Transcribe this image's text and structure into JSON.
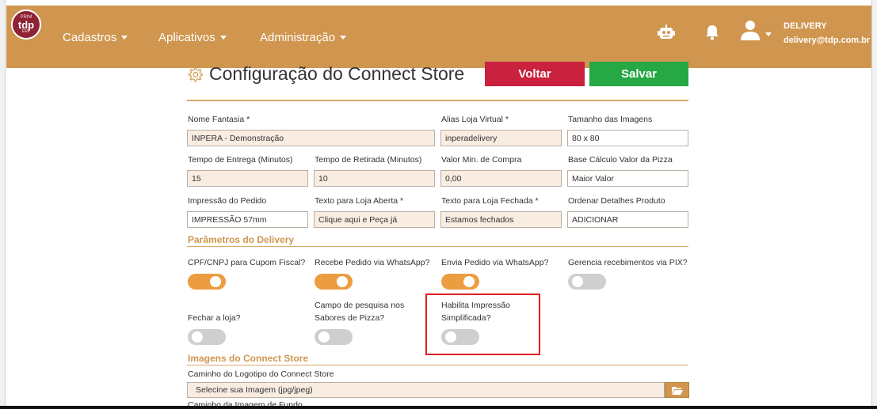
{
  "navbar": {
    "logo": {
      "top": "PRIM",
      "text": "tdp",
      "bottom": "ERP"
    },
    "menus": [
      {
        "label": "Cadastros"
      },
      {
        "label": "Aplicativos"
      },
      {
        "label": "Administração"
      }
    ],
    "user": {
      "name": "DELIVERY",
      "email": "delivery@tdp.com.br"
    },
    "colors": {
      "brand": "#d0964f"
    }
  },
  "page": {
    "title": "Configuração do Connect Store",
    "back_label": "Voltar",
    "save_label": "Salvar"
  },
  "form": {
    "nome_fantasia": {
      "label": "Nome Fantasia *",
      "value": "INPERA - Demonstração"
    },
    "alias": {
      "label": "Alias Loja Virtual *",
      "value": "inperadelivery"
    },
    "tamanho_imagens": {
      "label": "Tamanho das Imagens",
      "value": "80 x 80"
    },
    "tempo_entrega": {
      "label": "Tempo de Entrega (Minutos)",
      "value": "15"
    },
    "tempo_retirada": {
      "label": "Tempo de Retirada (Minutos)",
      "value": "10"
    },
    "valor_min": {
      "label": "Valor Min. de Compra",
      "value": "0,00"
    },
    "base_calculo": {
      "label": "Base Cálculo Valor da Pizza",
      "value": "Maior Valor"
    },
    "impressao": {
      "label": "Impressão do Pedido",
      "value": "IMPRESSÃO 57mm"
    },
    "texto_aberta": {
      "label": "Texto para Loja Aberta *",
      "value": "Clique aqui e Peça já"
    },
    "texto_fechada": {
      "label": "Texto para Loja Fechada *",
      "value": "Estamos fechados"
    },
    "ordenar": {
      "label": "Ordenar Detalhes Produto",
      "value": "ADICIONAR"
    }
  },
  "params": {
    "title": "Parâmetros do Delivery",
    "cpf": {
      "label": "CPF/CNPJ para Cupom Fiscal?",
      "on": true
    },
    "recebe_whatsapp": {
      "label": "Recebe Pedido via WhatsApp?",
      "on": true
    },
    "envia_whatsapp": {
      "label": "Envia Pedido via WhatsApp?",
      "on": true
    },
    "pix": {
      "label": "Gerencia recebimentos via PIX?",
      "on": false
    },
    "fechar": {
      "label": "Fechar a loja?",
      "on": false
    },
    "campo_pesquisa": {
      "label_line1": "Campo de pesquisa nos",
      "label_line2": "Sabores de Pizza?",
      "on": false
    },
    "impressao_simplificada": {
      "label_line1": "Habilita Impressão",
      "label_line2": "Simplificada?",
      "on": false
    }
  },
  "images": {
    "title": "Imagens do Connect Store",
    "logo_label": "Caminho do Logotipo do Connect Store",
    "logo_placeholder": "Selecine sua Imagem (jpg/jpeg)",
    "fundo_label": "Caminho da Imagem de Fundo"
  }
}
